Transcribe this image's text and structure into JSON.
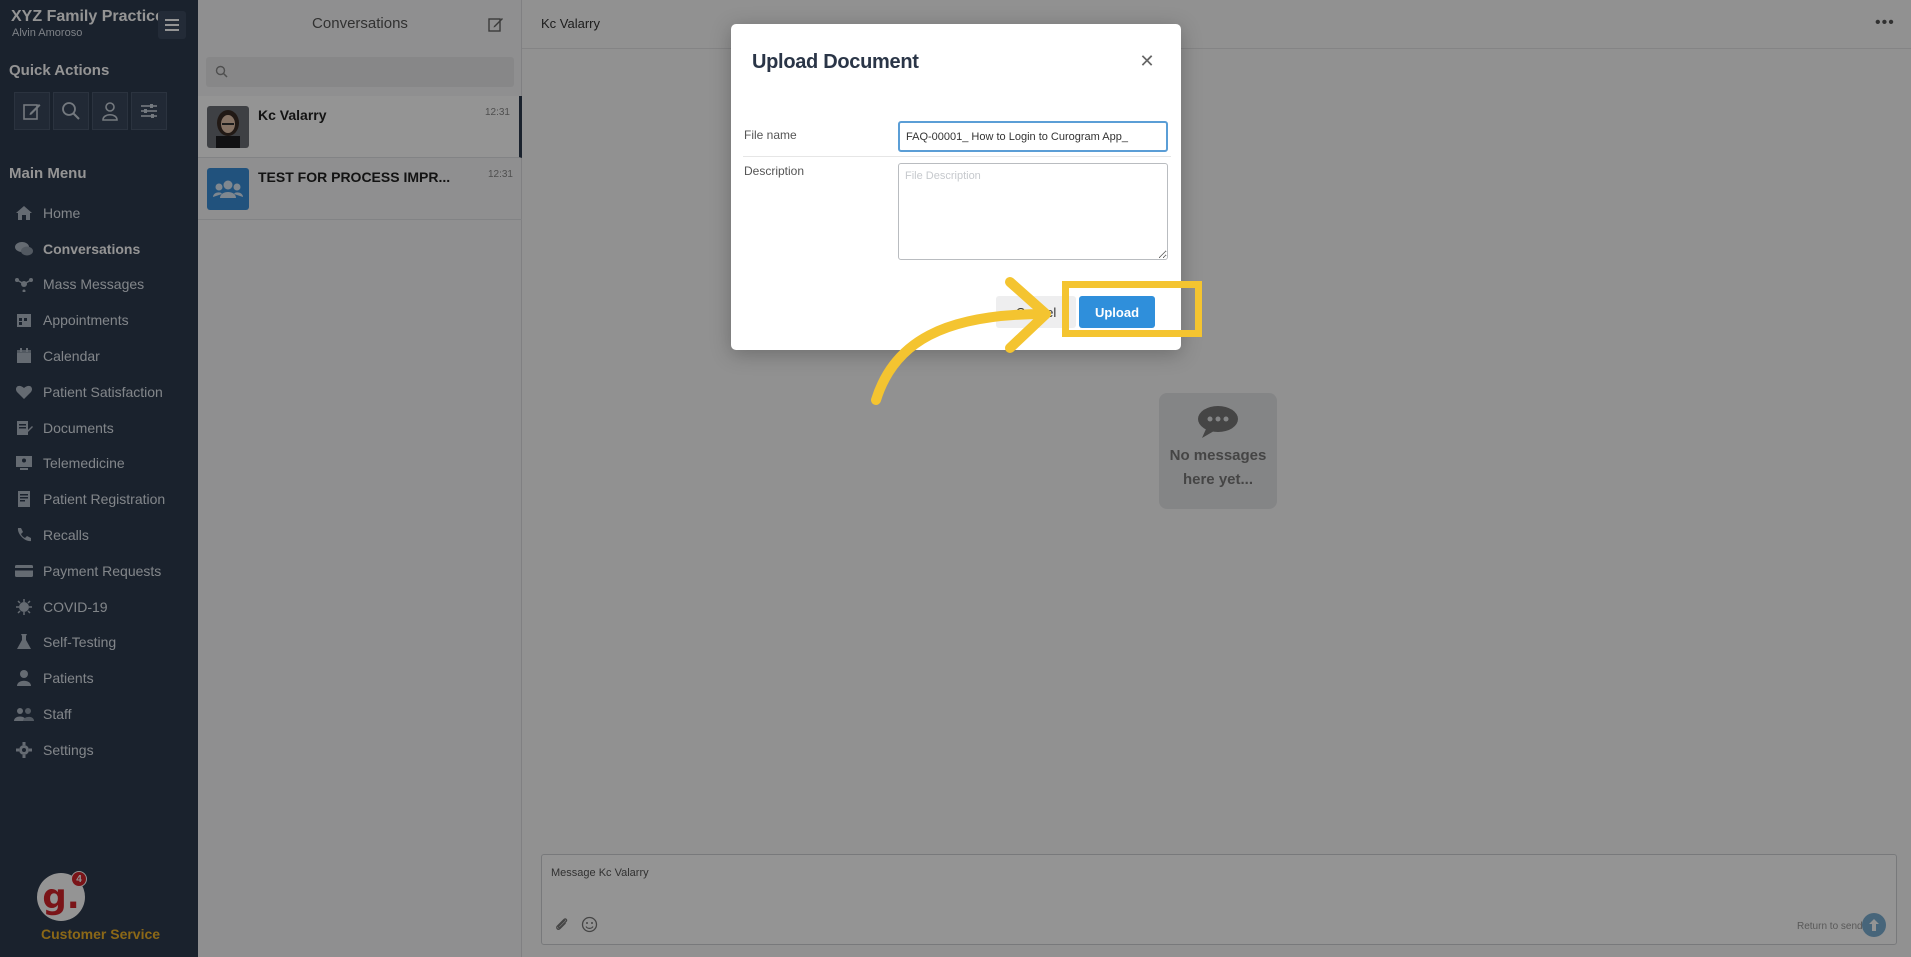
{
  "sidebar": {
    "brand": "XYZ Family Practice",
    "user": "Alvin Amoroso",
    "quick_actions_title": "Quick Actions",
    "main_menu_title": "Main Menu",
    "items": [
      {
        "label": "Home",
        "icon": "home-icon"
      },
      {
        "label": "Conversations",
        "icon": "chat-bubbles-icon"
      },
      {
        "label": "Mass Messages",
        "icon": "broadcast-icon"
      },
      {
        "label": "Appointments",
        "icon": "appointments-icon"
      },
      {
        "label": "Calendar",
        "icon": "calendar-icon"
      },
      {
        "label": "Patient Satisfaction",
        "icon": "heart-icon"
      },
      {
        "label": "Documents",
        "icon": "documents-icon"
      },
      {
        "label": "Telemedicine",
        "icon": "telemedicine-icon"
      },
      {
        "label": "Patient Registration",
        "icon": "registration-icon"
      },
      {
        "label": "Recalls",
        "icon": "phone-icon"
      },
      {
        "label": "Payment Requests",
        "icon": "credit-card-icon"
      },
      {
        "label": "COVID-19",
        "icon": "virus-icon"
      },
      {
        "label": "Self-Testing",
        "icon": "flask-icon"
      },
      {
        "label": "Patients",
        "icon": "person-icon"
      },
      {
        "label": "Staff",
        "icon": "staff-icon"
      },
      {
        "label": "Settings",
        "icon": "gear-icon"
      }
    ],
    "customer_service": {
      "label": "Customer Service",
      "badge": "4",
      "logo_letter": "g."
    }
  },
  "conversations": {
    "title": "Conversations",
    "search_placeholder": "",
    "items": [
      {
        "name": "Kc Valarry",
        "time": "12:31"
      },
      {
        "name": "TEST FOR PROCESS IMPR...",
        "time": "12:31"
      }
    ]
  },
  "chat": {
    "title": "Kc Valarry",
    "empty_text": "No messages here yet...",
    "composer_placeholder": "Message Kc Valarry",
    "return_hint": "Return to send"
  },
  "modal": {
    "title": "Upload Document",
    "file_label": "File name",
    "file_value": "FAQ-00001_ How to Login to Curogram App_",
    "description_label": "Description",
    "description_placeholder": "File Description",
    "cancel_label": "Cancel",
    "upload_label": "Upload"
  },
  "colors": {
    "sidebar_bg": "#2e3b4e",
    "accent": "#2f8fdb",
    "highlight": "#f4c430",
    "brand_red": "#d2232a"
  }
}
